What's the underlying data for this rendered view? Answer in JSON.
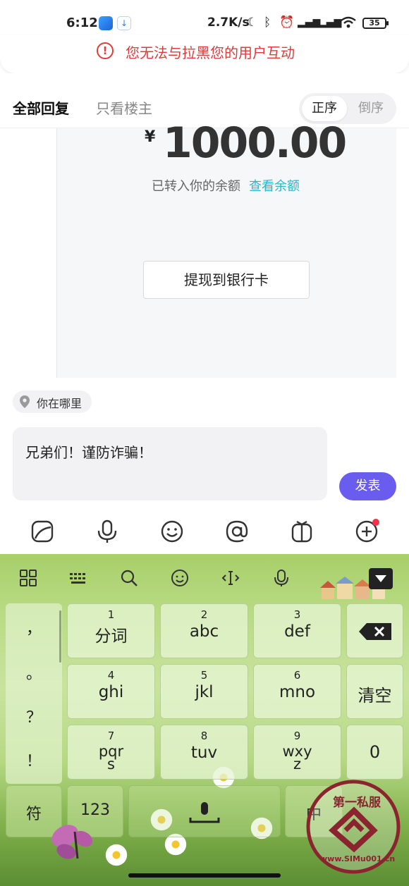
{
  "status_bar": {
    "time": "6:12",
    "net_speed": "2.7K/s",
    "battery": "35"
  },
  "warning": {
    "text": "您无法与拉黑您的用户互动",
    "icon": "!",
    "color": "#e03a3a"
  },
  "tabs": {
    "all_replies": "全部回复",
    "only_op": "只看楼主",
    "sort_asc": "正序",
    "sort_desc": "倒序"
  },
  "content": {
    "currency": "¥",
    "amount": "1000.00",
    "balance_text": "已转入你的余额",
    "balance_link": "查看余额",
    "withdraw_button": "提现到银行卡"
  },
  "composer": {
    "location": "你在哪里",
    "text": "兄弟们！谨防诈骗！",
    "send": "发表",
    "send_color": "#6b5cf0"
  },
  "keyboard": {
    "keys": [
      {
        "num": "1",
        "label": "分词"
      },
      {
        "num": "2",
        "label": "abc"
      },
      {
        "num": "3",
        "label": "def"
      },
      {
        "num": "4",
        "label": "ghi"
      },
      {
        "num": "5",
        "label": "jkl"
      },
      {
        "num": "6",
        "label": "mno"
      },
      {
        "num": "7",
        "label": "pqrs"
      },
      {
        "num": "8",
        "label": "tuv"
      },
      {
        "num": "9",
        "label": "wxyz"
      }
    ],
    "clear": "清空",
    "zero": "0",
    "punctuation": [
      "，",
      "。",
      "？",
      "！"
    ],
    "symbols": "符",
    "num_mode": "123",
    "lang_mode": "中"
  },
  "watermark": {
    "text": "第一私服",
    "url": "www.SIMu001.cn"
  }
}
